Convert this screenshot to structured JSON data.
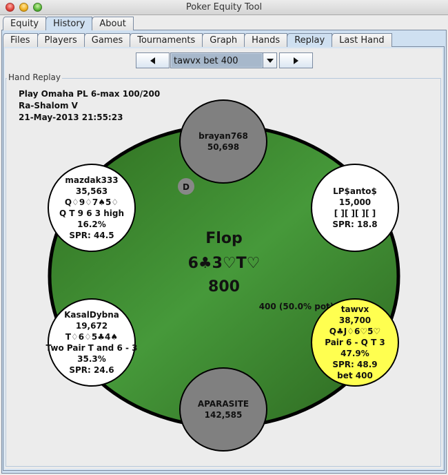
{
  "window": {
    "title": "Poker Equity Tool"
  },
  "top_tabs": [
    {
      "label": "Equity",
      "active": false
    },
    {
      "label": "History",
      "active": true
    },
    {
      "label": "About",
      "active": false
    }
  ],
  "sub_tabs": [
    {
      "label": "Files",
      "active": false
    },
    {
      "label": "Players",
      "active": false
    },
    {
      "label": "Games",
      "active": false
    },
    {
      "label": "Tournaments",
      "active": false
    },
    {
      "label": "Graph",
      "active": false
    },
    {
      "label": "Hands",
      "active": false
    },
    {
      "label": "Replay",
      "active": true
    },
    {
      "label": "Last Hand",
      "active": false
    }
  ],
  "replay_nav": {
    "prev_icon": "triangle-left-icon",
    "next_icon": "triangle-right-icon",
    "action_selected": "tawvx bet 400"
  },
  "hand_replay": {
    "group_title": "Hand Replay",
    "game": "Play Omaha PL 6-max 100/200",
    "table_name": "Ra-Shalom V",
    "datetime": "21-May-2013 21:55:23"
  },
  "table": {
    "felt_color": "#3f8a2c",
    "street": "Flop",
    "board": "6♣3♡T♡",
    "pot": "800",
    "bet_label": "400 (50.0% pot)",
    "dealer_label": "D",
    "seats": [
      {
        "position": "top",
        "fill": "#808080",
        "lines": [
          "brayan768",
          "50,698"
        ]
      },
      {
        "position": "top-right",
        "fill": "#ffffff",
        "lines": [
          "LP$anto$",
          "15,000",
          "[ ][ ][ ][ ]",
          "SPR: 18.8"
        ]
      },
      {
        "position": "bottom-right",
        "fill": "#ffff50",
        "lines": [
          "tawvx",
          "38,700",
          "Q♣J♢6♡5♡",
          "Pair 6 - Q T 3",
          "47.9%",
          "SPR: 48.9",
          "bet 400"
        ]
      },
      {
        "position": "bottom",
        "fill": "#808080",
        "lines": [
          "APARASITE",
          "142,585"
        ]
      },
      {
        "position": "bottom-left",
        "fill": "#ffffff",
        "lines": [
          "KasalDybna",
          "19,672",
          "T♢6♢5♣4♠",
          "Two Pair T and 6 - 3",
          "35.3%",
          "SPR: 24.6"
        ]
      },
      {
        "position": "top-left",
        "fill": "#ffffff",
        "lines": [
          "mazdak333",
          "35,563",
          "Q♢9♢7♠5♢",
          "Q T 9 6 3 high",
          "16.2%",
          "SPR: 44.5"
        ]
      }
    ]
  }
}
